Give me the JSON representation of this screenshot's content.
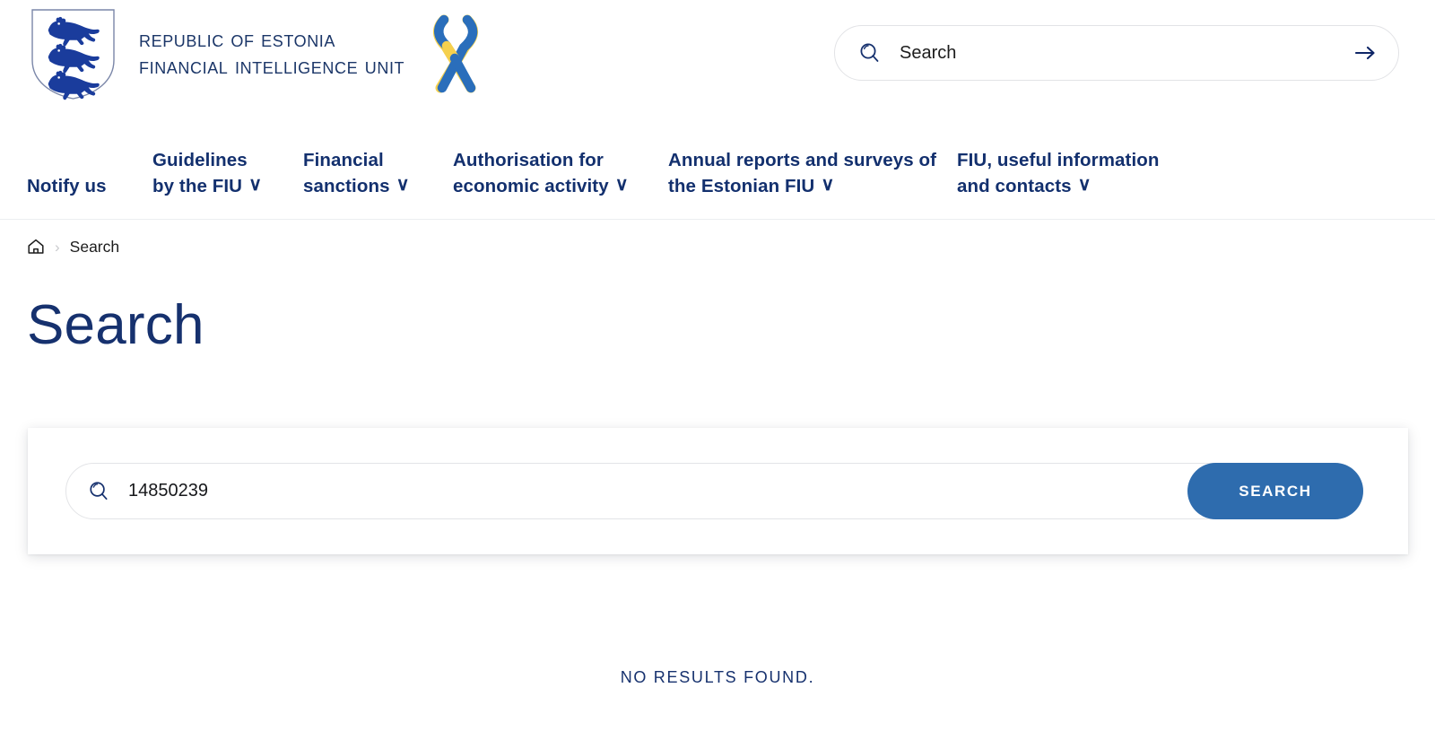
{
  "brand": {
    "line1": "Republic of Estonia",
    "line2": "Financial Intelligence Unit",
    "coat_icon": "estonian-coat-of-arms-three-lions",
    "ribbon_icon": "ukraine-solidarity-ribbon"
  },
  "header_search": {
    "placeholder": "Search",
    "value": "",
    "icon": "search-icon",
    "submit_icon": "arrow-right-icon"
  },
  "nav": {
    "items": [
      {
        "label": "Notify us",
        "has_caret": false
      },
      {
        "label": "Guidelines\nby the FIU",
        "has_caret": true
      },
      {
        "label": "Financial\nsanctions",
        "has_caret": true
      },
      {
        "label": "Authorisation for\neconomic activity",
        "has_caret": true
      },
      {
        "label": "Annual reports and surveys of\nthe Estonian FIU",
        "has_caret": true
      },
      {
        "label": "FIU, useful information\nand contacts",
        "has_caret": true
      }
    ],
    "caret_glyph": "∨"
  },
  "breadcrumb": {
    "home_icon": "home-icon",
    "separator": "›",
    "current": "Search"
  },
  "page": {
    "title": "Search"
  },
  "search_form": {
    "icon": "search-icon",
    "value": "14850239",
    "placeholder": "Search",
    "button_label": "SEARCH"
  },
  "results": {
    "empty_message": "NO RESULTS FOUND."
  },
  "colors": {
    "navy": "#16316e",
    "button_blue": "#2e6cae",
    "ribbon_blue": "#2a6ebb",
    "ribbon_yellow": "#f5d04e",
    "border_gray": "#e3e4e7"
  }
}
